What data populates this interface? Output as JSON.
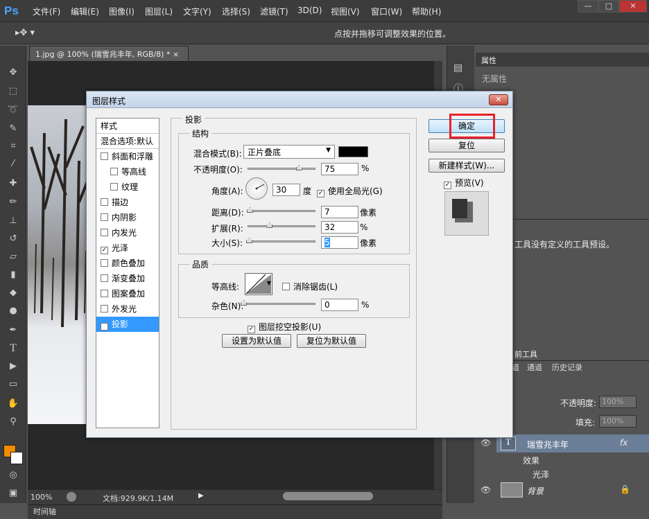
{
  "app": {
    "logo": "Ps"
  },
  "menu": [
    "文件(F)",
    "编辑(E)",
    "图像(I)",
    "图层(L)",
    "文字(Y)",
    "选择(S)",
    "滤镜(T)",
    "3D(D)",
    "视图(V)",
    "窗口(W)",
    "帮助(H)"
  ],
  "window_controls": [
    "—",
    "□",
    "✕"
  ],
  "options": {
    "hint": "点按并拖移可调整效果的位置。"
  },
  "document": {
    "tab": "1.jpg @ 100% (瑞雪兆丰年, RGB/8) *",
    "tab_close": "×"
  },
  "status": {
    "zoom": "100%",
    "doc": "文档:929.9K/1.14M"
  },
  "timeline": "时间轴",
  "panels": {
    "properties_tab": "属性",
    "properties_empty": "无属性",
    "tool_preset_msg": "工具没有定义的工具预设。",
    "current_tool": "前工具",
    "layers_tabs": [
      "道",
      "通道",
      "历史记录"
    ],
    "opacity_label": "不透明度:",
    "opacity_value": "100%",
    "fill_label": "填充:",
    "fill_value": "100%",
    "layer_text": "瑞雪兆丰年",
    "layer_fx": "fx",
    "effects_label": "效果",
    "effect_item": "光泽",
    "bg_layer": "背景"
  },
  "dialog": {
    "title": "图层样式",
    "close": "✕",
    "styles_header": "样式",
    "blend_default": "混合选项:默认",
    "style_items": [
      {
        "label": "斜面和浮雕",
        "checked": false,
        "indent": false
      },
      {
        "label": "等高线",
        "checked": false,
        "indent": true
      },
      {
        "label": "纹理",
        "checked": false,
        "indent": true
      },
      {
        "label": "描边",
        "checked": false,
        "indent": false
      },
      {
        "label": "内阴影",
        "checked": false,
        "indent": false
      },
      {
        "label": "内发光",
        "checked": false,
        "indent": false
      },
      {
        "label": "光泽",
        "checked": true,
        "indent": false
      },
      {
        "label": "颜色叠加",
        "checked": false,
        "indent": false
      },
      {
        "label": "渐变叠加",
        "checked": false,
        "indent": false
      },
      {
        "label": "图案叠加",
        "checked": false,
        "indent": false
      },
      {
        "label": "外发光",
        "checked": false,
        "indent": false
      },
      {
        "label": "投影",
        "checked": true,
        "indent": false,
        "selected": true
      }
    ],
    "section": "投影",
    "structure": "结构",
    "blend_mode_label": "混合模式(B):",
    "blend_mode_value": "正片叠底",
    "shadow_color": "#000000",
    "opacity_label": "不透明度(O):",
    "opacity_value": "75",
    "opacity_unit": "%",
    "angle_label": "角度(A):",
    "angle_value": "30",
    "angle_unit": "度",
    "global_light_label": "使用全局光(G)",
    "global_light_checked": true,
    "distance_label": "距离(D):",
    "distance_value": "7",
    "distance_unit": "像素",
    "spread_label": "扩展(R):",
    "spread_value": "32",
    "spread_unit": "%",
    "size_label": "大小(S):",
    "size_value": "5",
    "size_unit": "像素",
    "quality": "品质",
    "contour_label": "等高线:",
    "antialias_label": "消除锯齿(L)",
    "noise_label": "杂色(N):",
    "noise_value": "0",
    "noise_unit": "%",
    "knockout_label": "图层挖空投影(U)",
    "make_default": "设置为默认值",
    "reset_default": "复位为默认值",
    "ok": "确定",
    "reset": "复位",
    "new_style": "新建样式(W)...",
    "preview_label": "预览(V)",
    "preview_checked": true,
    "levels": {
      "opacity": 0.75,
      "distance": 0.03,
      "spread": 0.32,
      "size": 0.02,
      "noise": 0.0
    }
  }
}
